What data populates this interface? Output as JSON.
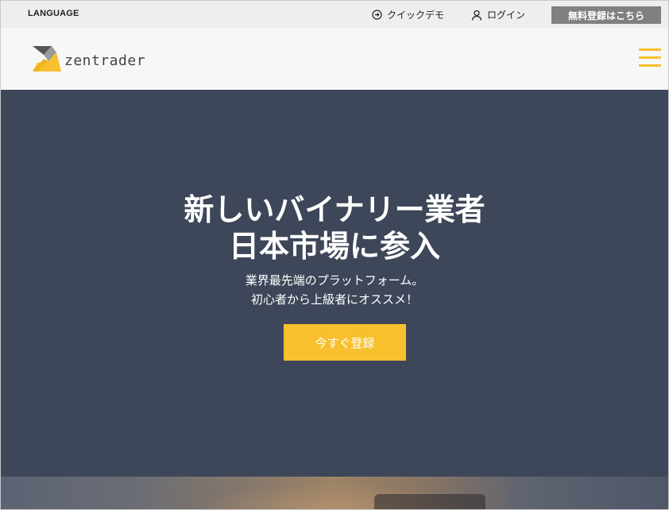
{
  "topbar": {
    "language_label": "LANGUAGE",
    "quick_demo_label": "クイックデモ",
    "login_label": "ログイン",
    "register_label": "無料登録はこちら"
  },
  "header": {
    "logo_text": "zentrader",
    "menu_icon": "hamburger-menu-icon"
  },
  "hero": {
    "title_line1": "新しいバイナリー業者",
    "title_line2": "日本市場に参入",
    "subtitle_line1": "業界最先端のプラットフォーム。",
    "subtitle_line2": "初心者から上級者にオススメ！",
    "cta_label": "今すぐ登録"
  },
  "colors": {
    "accent_yellow": "#f9c02d",
    "hero_bg": "#3e4759",
    "topbar_bg": "#eeeeee",
    "header_bg": "#f7f7f7",
    "register_btn_bg": "#808080"
  }
}
